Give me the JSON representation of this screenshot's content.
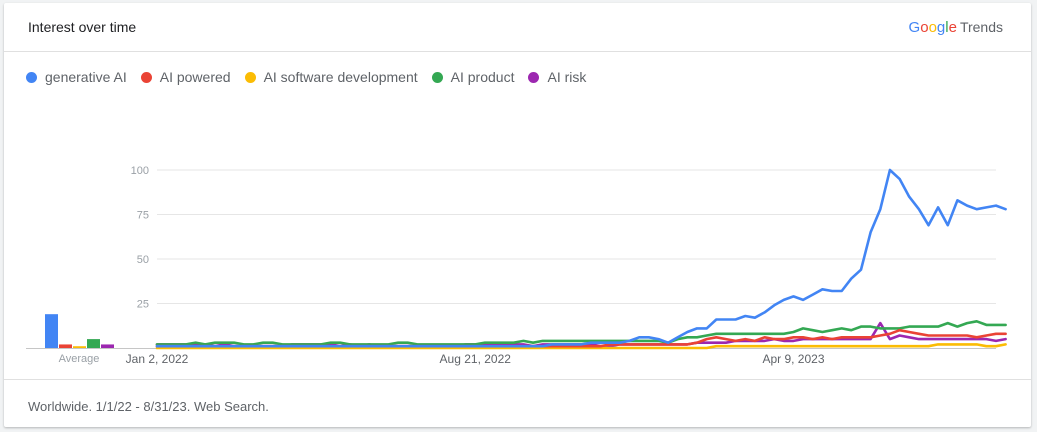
{
  "header": {
    "title": "Interest over time",
    "brand_letters": [
      {
        "ch": "G",
        "color": "#4285f4"
      },
      {
        "ch": "o",
        "color": "#ea4335"
      },
      {
        "ch": "o",
        "color": "#fbbc04"
      },
      {
        "ch": "g",
        "color": "#4285f4"
      },
      {
        "ch": "l",
        "color": "#34a853"
      },
      {
        "ch": "e",
        "color": "#ea4335"
      }
    ],
    "brand_suffix": "Trends"
  },
  "footer": {
    "text": "Worldwide. 1/1/22 - 8/31/23. Web Search."
  },
  "averages_label": "Average",
  "chart_data": {
    "type": "line",
    "y_ticks": [
      "100",
      "75",
      "50",
      "25"
    ],
    "ylim": [
      0,
      100
    ],
    "x_tick_labels": [
      {
        "label": "Jan 2, 2022",
        "week": 0
      },
      {
        "label": "Aug 21, 2022",
        "week": 33
      },
      {
        "label": "Apr 9, 2023",
        "week": 66
      }
    ],
    "week_count": 87,
    "series": [
      {
        "name": "generative AI",
        "color": "#4285f4",
        "average": 19,
        "values": [
          1,
          1,
          1,
          1,
          1,
          1,
          1,
          1,
          1,
          1,
          1,
          1,
          1,
          1,
          1,
          1,
          1,
          1,
          1,
          1,
          1,
          1,
          1,
          1,
          1,
          1,
          1,
          1,
          1,
          1,
          1,
          1,
          1,
          1,
          1,
          1,
          1,
          1,
          1,
          1,
          1,
          2,
          2,
          2,
          2,
          3,
          3,
          3,
          3,
          4,
          6,
          6,
          5,
          3,
          6,
          9,
          11,
          11,
          16,
          16,
          16,
          18,
          17,
          20,
          24,
          27,
          29,
          27,
          30,
          33,
          32,
          32,
          39,
          44,
          65,
          78,
          100,
          95,
          85,
          78,
          69,
          79,
          69,
          83,
          80,
          78,
          79,
          80,
          78
        ]
      },
      {
        "name": "AI powered",
        "color": "#ea4335",
        "average": 2,
        "values": [
          1,
          1,
          1,
          1,
          1,
          1,
          1,
          1,
          1,
          1,
          1,
          1,
          1,
          1,
          1,
          1,
          1,
          1,
          1,
          1,
          1,
          1,
          1,
          1,
          1,
          1,
          1,
          1,
          1,
          1,
          1,
          1,
          1,
          1,
          1,
          1,
          1,
          1,
          1,
          1,
          1,
          1,
          1,
          1,
          1,
          1,
          1,
          2,
          2,
          2,
          2,
          2,
          2,
          2,
          2,
          2,
          3,
          5,
          6,
          5,
          4,
          5,
          4,
          6,
          5,
          5,
          6,
          6,
          5,
          6,
          5,
          6,
          6,
          6,
          6,
          7,
          8,
          10,
          9,
          8,
          7,
          7,
          7,
          7,
          7,
          6,
          7,
          8,
          8
        ]
      },
      {
        "name": "AI software development",
        "color": "#fbbc04",
        "average": 1,
        "values": [
          0,
          0,
          0,
          0,
          0,
          0,
          0,
          0,
          0,
          0,
          0,
          0,
          0,
          0,
          0,
          0,
          0,
          0,
          0,
          0,
          0,
          0,
          0,
          0,
          0,
          0,
          0,
          0,
          0,
          0,
          0,
          0,
          0,
          0,
          0,
          0,
          0,
          0,
          0,
          0,
          0,
          0,
          0,
          0,
          0,
          0,
          0,
          0,
          0,
          0,
          0,
          0,
          0,
          0,
          0,
          0,
          0,
          0,
          1,
          1,
          1,
          1,
          1,
          1,
          1,
          1,
          1,
          1,
          1,
          1,
          1,
          1,
          1,
          1,
          1,
          1,
          1,
          1,
          1,
          1,
          1,
          2,
          2,
          2,
          2,
          2,
          1,
          1,
          2
        ]
      },
      {
        "name": "AI product",
        "color": "#34a853",
        "average": 5,
        "values": [
          2,
          2,
          2,
          2,
          3,
          2,
          3,
          3,
          3,
          2,
          2,
          3,
          3,
          2,
          2,
          2,
          2,
          2,
          3,
          3,
          2,
          2,
          2,
          2,
          2,
          3,
          3,
          2,
          2,
          2,
          2,
          2,
          2,
          2,
          3,
          3,
          3,
          3,
          4,
          3,
          4,
          4,
          4,
          4,
          4,
          4,
          4,
          4,
          4,
          4,
          4,
          4,
          4,
          3,
          5,
          6,
          6,
          7,
          8,
          8,
          8,
          8,
          8,
          8,
          8,
          8,
          9,
          11,
          10,
          9,
          10,
          11,
          10,
          12,
          12,
          11,
          11,
          11,
          12,
          12,
          12,
          12,
          14,
          12,
          14,
          15,
          13,
          13,
          13
        ]
      },
      {
        "name": "AI risk",
        "color": "#9c27b0",
        "average": 2,
        "values": [
          2,
          2,
          2,
          2,
          2,
          2,
          1,
          2,
          1,
          1,
          1,
          1,
          1,
          1,
          2,
          2,
          2,
          2,
          2,
          1,
          2,
          1,
          2,
          1,
          1,
          1,
          1,
          1,
          1,
          1,
          1,
          1,
          2,
          2,
          2,
          2,
          2,
          2,
          2,
          1,
          2,
          2,
          2,
          2,
          2,
          2,
          1,
          1,
          2,
          2,
          2,
          2,
          2,
          2,
          2,
          2,
          3,
          3,
          3,
          3,
          4,
          4,
          4,
          4,
          5,
          4,
          4,
          5,
          5,
          5,
          5,
          5,
          5,
          5,
          5,
          14,
          5,
          7,
          6,
          5,
          5,
          5,
          5,
          5,
          5,
          5,
          5,
          4,
          5
        ]
      }
    ]
  }
}
